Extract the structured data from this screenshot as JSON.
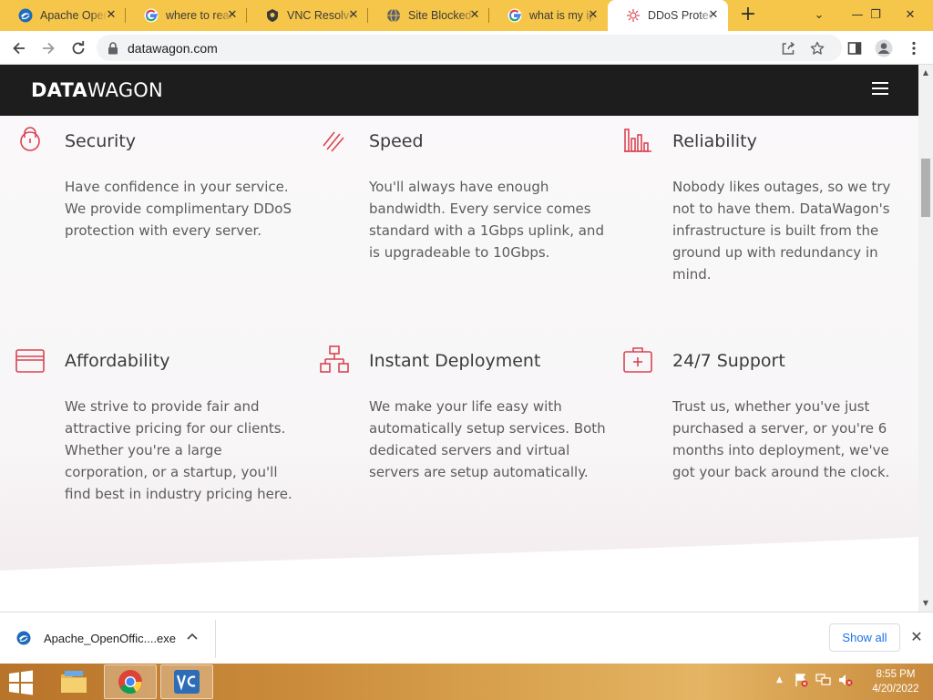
{
  "browser": {
    "tabs": [
      {
        "title": "Apache OpenOffice",
        "icon": "openoffice-icon",
        "active": false
      },
      {
        "title": "where to read",
        "icon": "google-icon",
        "active": false
      },
      {
        "title": "VNC Resolver",
        "icon": "vnc-resolver-icon",
        "active": false
      },
      {
        "title": "Site Blocked",
        "icon": "globe-icon",
        "active": false
      },
      {
        "title": "what is my ip",
        "icon": "google-icon",
        "active": false
      },
      {
        "title": "DDoS Protection",
        "icon": "datawagon-icon",
        "active": true
      }
    ],
    "new_tab_label": "+",
    "window_controls": {
      "dropdown": "⌄",
      "minimize": "—",
      "restore": "❐",
      "close": "✕"
    },
    "url": "datawagon.com"
  },
  "site": {
    "logo_bold": "DATA",
    "logo_light": "WAGON",
    "accent_color": "#d94452",
    "features": [
      {
        "icon": "lock-icon",
        "title": "Security",
        "text": "Have confidence in your service. We provide complimentary DDoS protection with every server."
      },
      {
        "icon": "speed-icon",
        "title": "Speed",
        "text": "You'll always have enough bandwidth. Every service comes standard with a 1Gbps uplink, and is upgradeable to 10Gbps."
      },
      {
        "icon": "bar-chart-icon",
        "title": "Reliability",
        "text": "Nobody likes outages, so we try not to have them. DataWagon's infrastructure is built from the ground up with redundancy in mind."
      },
      {
        "icon": "credit-card-icon",
        "title": "Affordability",
        "text": "We strive to provide fair and attractive pricing for our clients. Whether you're a large corporation, or a startup, you'll find best in industry pricing here."
      },
      {
        "icon": "network-icon",
        "title": "Instant Deployment",
        "text": "We make your life easy with automatically setup services. Both dedicated servers and virtual servers are setup automatically."
      },
      {
        "icon": "first-aid-kit-icon",
        "title": "24/7 Support",
        "text": "Trust us, whether you've just purchased a server, or you're 6 months into deployment, we've got your back around the clock."
      }
    ]
  },
  "downloads": {
    "file_name": "Apache_OpenOffic....exe",
    "show_all_label": "Show all"
  },
  "taskbar": {
    "apps": [
      "file-explorer-icon",
      "chrome-icon",
      "vnc-viewer-icon"
    ],
    "time": "8:55 PM",
    "date": "4/20/2022"
  }
}
